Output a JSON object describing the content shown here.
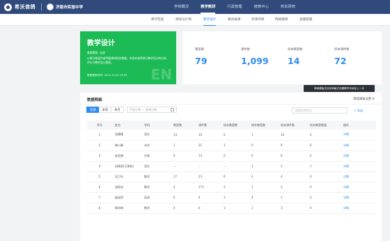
{
  "header": {
    "brand": "希沃信鸽",
    "school": "济南市实验中学",
    "nav": [
      "学校概况",
      "教学教研",
      "行政管理",
      "德育中心",
      "校本研修"
    ],
    "active_nav": 1
  },
  "subnav": {
    "items": [
      "教学检查",
      "目标与计划",
      "教学设计",
      "集体备课",
      "听课评课",
      "网络教研",
      "直播管理"
    ],
    "active": 2
  },
  "hero": {
    "title": "教学设计",
    "teacher": "查看模板: 全部",
    "description": "以便为校园内老师备课的相关数据，实现对老师进行教学设计的分析、评价与教学设计提质。",
    "update_time": "数据更新时间: 2024.10.25 23:59",
    "watermark": "EN"
  },
  "stats": [
    {
      "label": "教案数",
      "value": "79"
    },
    {
      "label": "课件数",
      "value": "1,099"
    },
    {
      "label": "校本教案数",
      "value": "14"
    },
    {
      "label": "校本课件数",
      "value": "72"
    }
  ],
  "tooltip": "教案模板支持多种格式设置教学本地化上一步",
  "panel": {
    "title": "数据明细",
    "template_button": "教案模板设置",
    "filters": [
      "全部",
      "本周",
      "本月"
    ],
    "active_filter": 0,
    "date_start_placeholder": "开始日期",
    "date_to": "~",
    "date_end_placeholder": "结束日期",
    "search_placeholder": "搜索老师姓名",
    "export_label": "导出"
  },
  "table": {
    "headers": [
      "序号",
      "姓名",
      "学科",
      "教案数",
      "课件数",
      "校本数量数",
      "校本教案数",
      "校本课件数",
      "校本教案数量",
      "操作"
    ],
    "rows": [
      [
        "1",
        "张珊珊",
        "语文",
        "14",
        "10",
        "0",
        "1",
        "10",
        "0",
        "详情"
      ],
      [
        "2",
        "喻小静",
        "化学",
        "1",
        "21",
        "1",
        "0",
        "9",
        "0",
        "详情"
      ],
      [
        "3",
        "赵亚娟",
        "生物",
        "0",
        "14",
        "0",
        "0",
        "6",
        "0",
        "详情"
      ],
      [
        "4",
        "田晓凯(已离校)",
        "语文",
        "--",
        "--",
        "--",
        "3",
        "3",
        "1",
        "详情"
      ],
      [
        "5",
        "吴卫东",
        "数学",
        "17",
        "23",
        "0",
        "4",
        "4",
        "0",
        "详情"
      ],
      [
        "6",
        "张昭也",
        "数学",
        "4",
        "173",
        "2",
        "1",
        "3",
        "0",
        "详情"
      ],
      [
        "7",
        "姚淑萍",
        "英语",
        "0",
        "4",
        "1",
        "4",
        "1",
        "0",
        "详情"
      ],
      [
        "8",
        "郭庆梅",
        "数学",
        "4",
        "6",
        "1",
        "1",
        "3",
        "0",
        "详情"
      ]
    ]
  },
  "colors": {
    "topbar": "#2f4a7b",
    "accent": "#2d8cf0",
    "hero": "#1cbb55"
  },
  "icons": {
    "settings": "gear-icon",
    "export": "export-icon",
    "calendar": "calendar-icon",
    "search": "search-icon"
  }
}
